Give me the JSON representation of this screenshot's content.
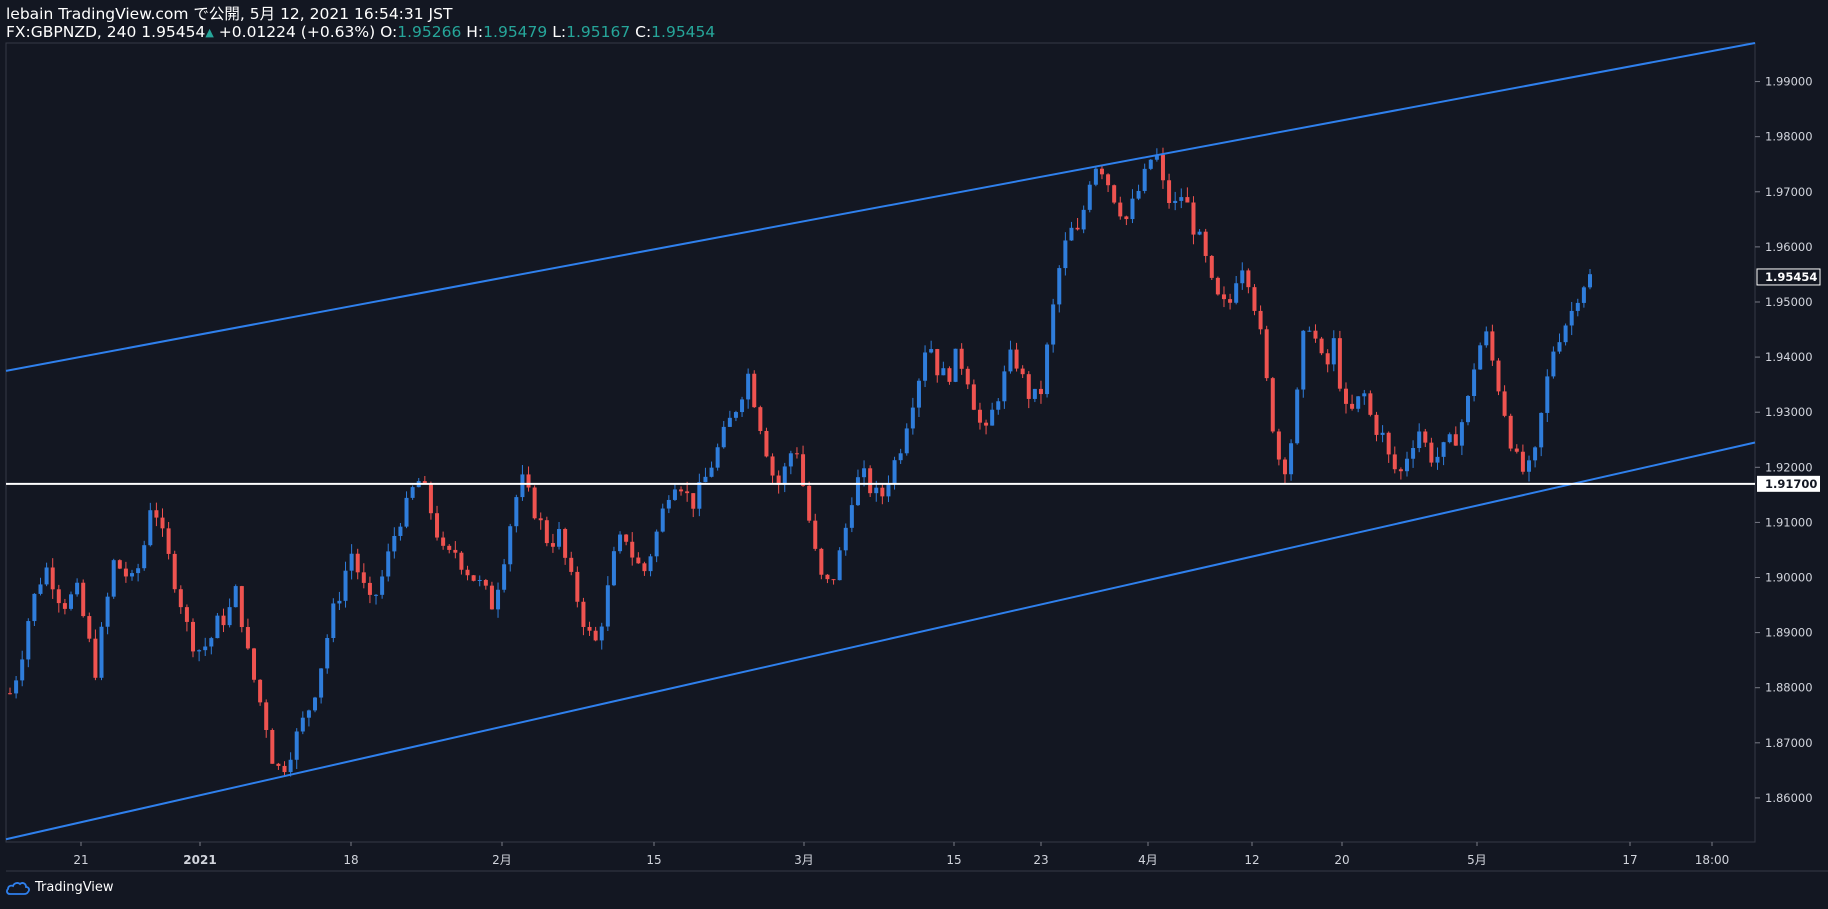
{
  "header": {
    "publisher": "lebain TradingView.com で公開, 5月 12, 2021 16:54:31 JST",
    "symbol": "FX:GBPNZD, 240",
    "last": "1.95454",
    "change": "+0.01224 (+0.63%)",
    "o_label": "O:",
    "open": "1.95266",
    "h_label": "H:",
    "high": "1.95479",
    "l_label": "L:",
    "low": "1.95167",
    "c_label": "C:",
    "close": "1.95454"
  },
  "footer": {
    "brand": "TradingView"
  },
  "colors": {
    "background": "#131722",
    "up": "#2f7ddb",
    "down": "#ef5350",
    "channel": "#2f80ed",
    "support": "#ffffff",
    "axis_text": "#d1d4dc"
  },
  "chart_data": {
    "type": "candlestick",
    "symbol": "FX:GBPNZD",
    "interval": "240",
    "ylim": [
      1.852,
      1.997
    ],
    "y_ticks": [
      "1.99000",
      "1.98000",
      "1.97000",
      "1.96000",
      "1.95000",
      "1.94000",
      "1.93000",
      "1.92000",
      "1.91000",
      "1.90000",
      "1.89000",
      "1.88000",
      "1.87000",
      "1.86000"
    ],
    "x_ticks": [
      "21",
      "2021",
      "18",
      "2月",
      "15",
      "3月",
      "15",
      "23",
      "4月",
      "12",
      "20",
      "5月",
      "17",
      "18:00"
    ],
    "price_labels": [
      {
        "value": "1.95454",
        "type": "last"
      },
      {
        "value": "1.91700",
        "type": "support"
      }
    ],
    "support_level": 1.917,
    "channel_upper": {
      "start": 1.9375,
      "end": 1.997
    },
    "channel_lower": {
      "start": 1.8525,
      "end": 1.9245
    },
    "close_path": [
      1.879,
      1.884,
      1.893,
      1.899,
      1.902,
      1.897,
      1.895,
      1.898,
      1.891,
      1.883,
      1.893,
      1.903,
      1.901,
      1.899,
      1.904,
      1.915,
      1.908,
      1.902,
      1.896,
      1.889,
      1.887,
      1.888,
      1.892,
      1.893,
      1.898,
      1.887,
      1.88,
      1.874,
      1.865,
      1.866,
      1.87,
      1.874,
      1.878,
      1.885,
      1.893,
      1.898,
      1.905,
      1.9,
      1.895,
      1.898,
      1.904,
      1.91,
      1.913,
      1.918,
      1.915,
      1.909,
      1.903,
      1.905,
      1.902,
      1.9,
      1.898,
      1.895,
      1.902,
      1.911,
      1.918,
      1.914,
      1.91,
      1.906,
      1.908,
      1.901,
      1.896,
      1.89,
      1.888,
      1.896,
      1.905,
      1.908,
      1.903,
      1.901,
      1.906,
      1.912,
      1.918,
      1.917,
      1.913,
      1.916,
      1.92,
      1.924,
      1.928,
      1.932,
      1.937,
      1.93,
      1.923,
      1.916,
      1.92,
      1.925,
      1.915,
      1.905,
      1.898,
      1.9,
      1.906,
      1.915,
      1.919,
      1.916,
      1.914,
      1.919,
      1.923,
      1.93,
      1.936,
      1.944,
      1.938,
      1.936,
      1.94,
      1.938,
      1.931,
      1.925,
      1.931,
      1.936,
      1.941,
      1.936,
      1.932,
      1.934,
      1.946,
      1.957,
      1.963,
      1.962,
      1.972,
      1.976,
      1.972,
      1.968,
      1.965,
      1.969,
      1.973,
      1.978,
      1.97,
      1.967,
      1.97,
      1.964,
      1.96,
      1.953,
      1.949,
      1.95,
      1.958,
      1.954,
      1.946,
      1.933,
      1.922,
      1.92,
      1.932,
      1.948,
      1.943,
      1.937,
      1.943,
      1.93,
      1.93,
      1.934,
      1.928,
      1.926,
      1.92,
      1.919,
      1.924,
      1.927,
      1.922,
      1.922,
      1.924,
      1.926,
      1.931,
      1.941,
      1.944,
      1.937,
      1.93,
      1.922,
      1.919,
      1.92,
      1.931,
      1.941,
      1.945,
      1.948,
      1.953,
      1.9545
    ]
  }
}
